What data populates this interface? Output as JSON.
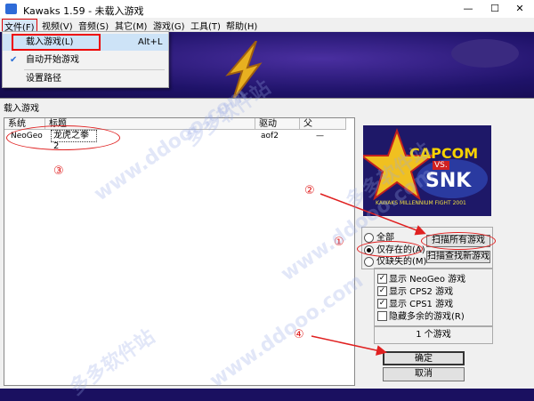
{
  "window": {
    "title": "Kawaks 1.59 - 未载入游戏",
    "minimize": "—",
    "maximize": "☐",
    "close": "✕"
  },
  "menubar": [
    "文件(F)",
    "视频(V)",
    "音频(S)",
    "其它(M)",
    "游戏(G)",
    "工具(T)",
    "帮助(H)"
  ],
  "file_menu": {
    "items": [
      {
        "label": "载入游戏(L)",
        "shortcut": "Alt+L"
      },
      {
        "label": "自动开始游戏",
        "checked": true
      },
      {
        "label": "设置路径"
      }
    ]
  },
  "dialog": {
    "title": "载入游戏",
    "columns": [
      "系统",
      "标题",
      "驱动",
      "父"
    ],
    "rows": [
      {
        "system": "NeoGeo",
        "title": "龙虎之拳 2",
        "driver": "aof2",
        "parent": "—"
      }
    ],
    "filter": {
      "options": [
        "全部",
        "仅存在的(A)",
        "仅缺失的(M)"
      ],
      "selected": 1
    },
    "scan_all_button": "扫描所有游戏",
    "scan_new_button": "扫描查找新游戏",
    "display_options": [
      {
        "label": "显示 NeoGeo 游戏",
        "checked": true
      },
      {
        "label": "显示 CPS2 游戏",
        "checked": true
      },
      {
        "label": "显示 CPS1 游戏",
        "checked": true
      },
      {
        "label": "隐藏多余的游戏(R)",
        "checked": false
      }
    ],
    "game_count": "1 个游戏",
    "ok_button": "确定",
    "cancel_button": "取消"
  },
  "preview_logo": {
    "capcom": "CAPCOM",
    "vs": "VS.",
    "snk": "SNK",
    "subtitle": "KAWAKS MILLENNIUM FIGHT 2001"
  },
  "annotations": [
    "①",
    "②",
    "③",
    "④"
  ],
  "watermarks": [
    "多多软件站",
    "www.ddooo.com",
    "多多软件站",
    "www.ddooo.com",
    "多多软件站",
    "www.ddooo.com"
  ],
  "colors": {
    "annotation": "#e02020",
    "selection": "#cde3f7"
  }
}
